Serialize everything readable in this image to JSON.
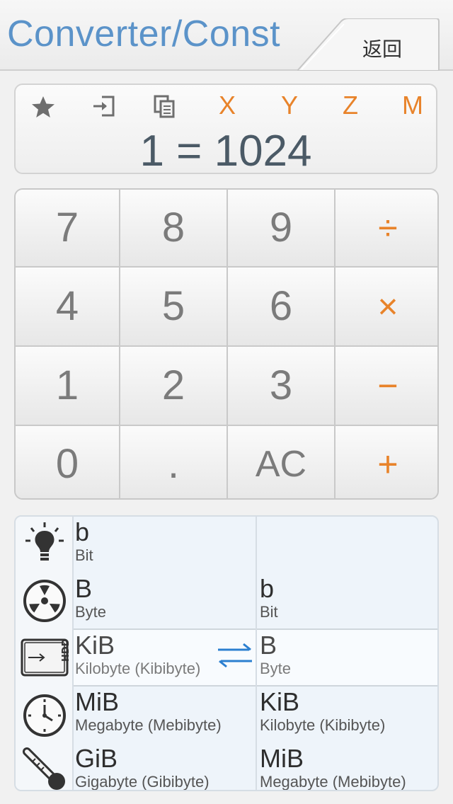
{
  "header": {
    "title": "Converter/Const",
    "back_label": "返回"
  },
  "display": {
    "tools": [
      {
        "icon": "star-icon"
      },
      {
        "icon": "import-icon"
      },
      {
        "icon": "copy-icon"
      }
    ],
    "memory_keys": [
      "X",
      "Y",
      "Z",
      "M"
    ],
    "expression": "1 = 1024"
  },
  "keypad": {
    "rows": [
      [
        "7",
        "8",
        "9",
        "÷"
      ],
      [
        "4",
        "5",
        "6",
        "×"
      ],
      [
        "1",
        "2",
        "3",
        "−"
      ],
      [
        "0",
        ".",
        "AC",
        "+"
      ]
    ]
  },
  "units": {
    "category_icons": [
      "lightbulb-icon",
      "radiation-icon",
      "hdd-icon",
      "clock-icon",
      "thermometer-icon"
    ],
    "rows": [
      {
        "from": {
          "symbol": "b",
          "name": "Bit"
        },
        "to": {
          "symbol": "",
          "name": ""
        }
      },
      {
        "from": {
          "symbol": "B",
          "name": "Byte"
        },
        "to": {
          "symbol": "b",
          "name": "Bit"
        }
      },
      {
        "from": {
          "symbol": "KiB",
          "name": "Kilobyte (Kibibyte)"
        },
        "to": {
          "symbol": "B",
          "name": "Byte"
        }
      },
      {
        "from": {
          "symbol": "MiB",
          "name": "Megabyte (Mebibyte)"
        },
        "to": {
          "symbol": "KiB",
          "name": "Kilobyte (Kibibyte)"
        }
      },
      {
        "from": {
          "symbol": "GiB",
          "name": "Gigabyte (Gibibyte)"
        },
        "to": {
          "symbol": "MiB",
          "name": "Megabyte (Mebibyte)"
        }
      }
    ],
    "colors": {
      "swap_arrow": "#2b7fd0",
      "accent": "#e8832a",
      "title": "#5b93c9"
    }
  }
}
